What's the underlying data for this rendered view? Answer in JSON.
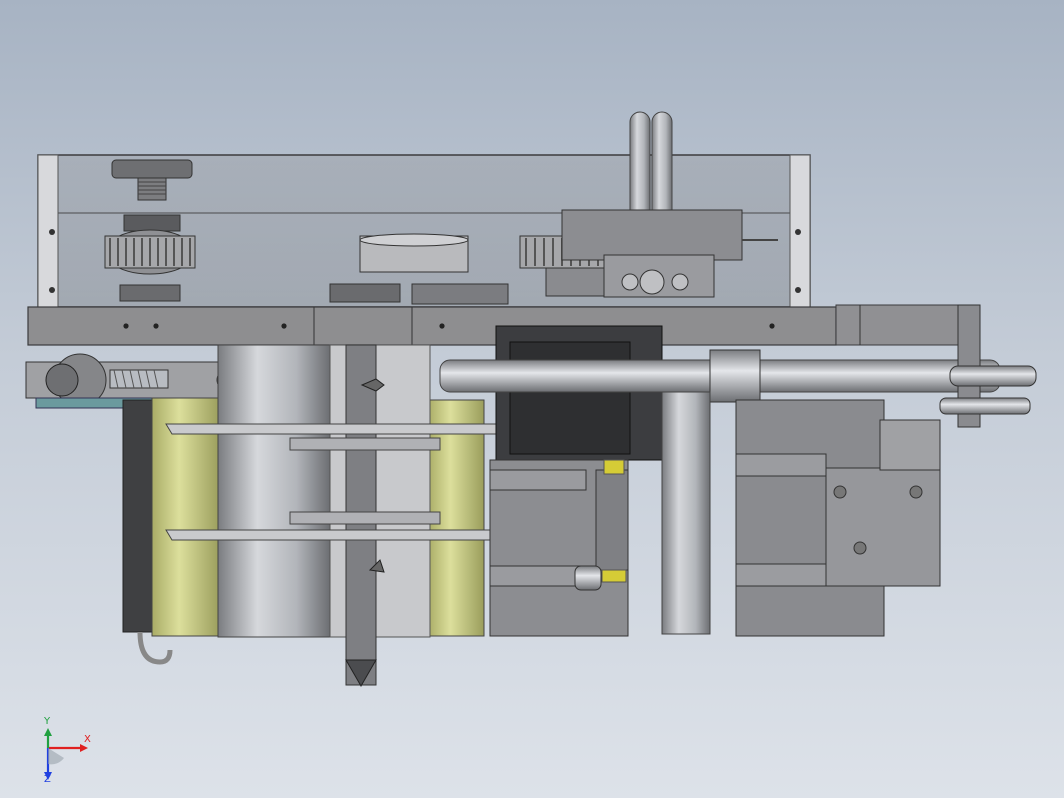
{
  "triad": {
    "x_label": "X",
    "y_label": "Y",
    "z_label": "Z"
  },
  "colors": {
    "background_top": "#a7b3c3",
    "background_bottom": "#dde2e9",
    "frame_gray": "#8e8e90",
    "dark_gray": "#4a4a4c",
    "olive_roller": "#c9cc86",
    "steel": "#b8bcc2",
    "x_axis": "#e02020",
    "y_axis": "#20a040",
    "z_axis": "#2040e0"
  }
}
